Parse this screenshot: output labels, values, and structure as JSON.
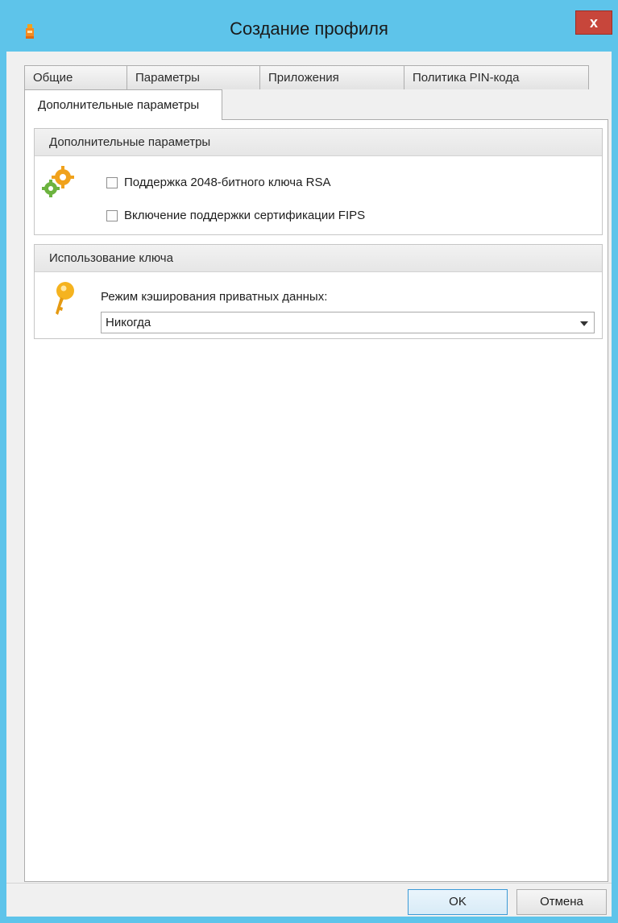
{
  "window": {
    "title": "Создание профиля",
    "close_label": "x"
  },
  "tabs": {
    "row": [
      "Общие",
      "Параметры",
      "Приложения",
      "Политика PIN-кода"
    ],
    "selected": "Дополнительные параметры"
  },
  "group_advanced": {
    "header": "Дополнительные параметры",
    "icon": "gears-icon",
    "options": [
      {
        "label": "Поддержка 2048-битного ключа RSA",
        "checked": false
      },
      {
        "label": "Включение поддержки сертификации FIPS",
        "checked": false
      }
    ]
  },
  "group_key": {
    "header": "Использование ключа",
    "icon": "key-icon",
    "cache_label": "Режим кэширования приватных данных:",
    "cache_value": "Никогда"
  },
  "buttons": {
    "ok": "OK",
    "cancel": "Отмена"
  },
  "colors": {
    "titlebar": "#5ec4ea",
    "close": "#c7463b",
    "body": "#f0f0f0"
  }
}
